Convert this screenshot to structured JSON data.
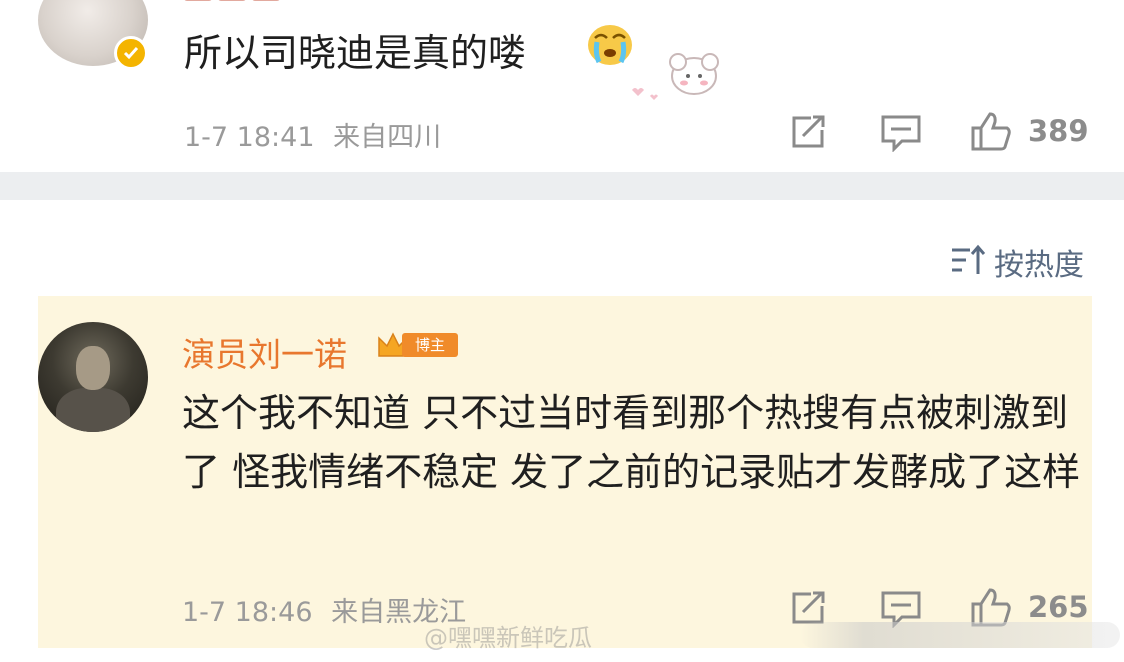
{
  "top_comment": {
    "text": "所以司晓迪是真的喽",
    "timestamp": "1-7 18:41",
    "location": "来自四川",
    "like_count": "389",
    "icons": [
      "share-icon",
      "comment-icon",
      "like-icon"
    ]
  },
  "sort": {
    "label": "按热度"
  },
  "author_comment": {
    "username": "演员刘一诺",
    "badge": "博主",
    "text": "这个我不知道 只不过当时看到那个热搜有点被刺激到了 怪我情绪不稳定 发了之前的记录贴才发酵成了这样",
    "timestamp": "1-7 18:46",
    "location": "来自黑龙江",
    "like_count": "265"
  },
  "watermark": {
    "text": "@嘿嘿新鲜吃瓜"
  },
  "colors": {
    "highlight_bg": "#fdf6de",
    "author_name": "#e8772e",
    "meta_text": "#9a9a9a",
    "divider": "#eceef0",
    "sort_text": "#5a6b82"
  }
}
